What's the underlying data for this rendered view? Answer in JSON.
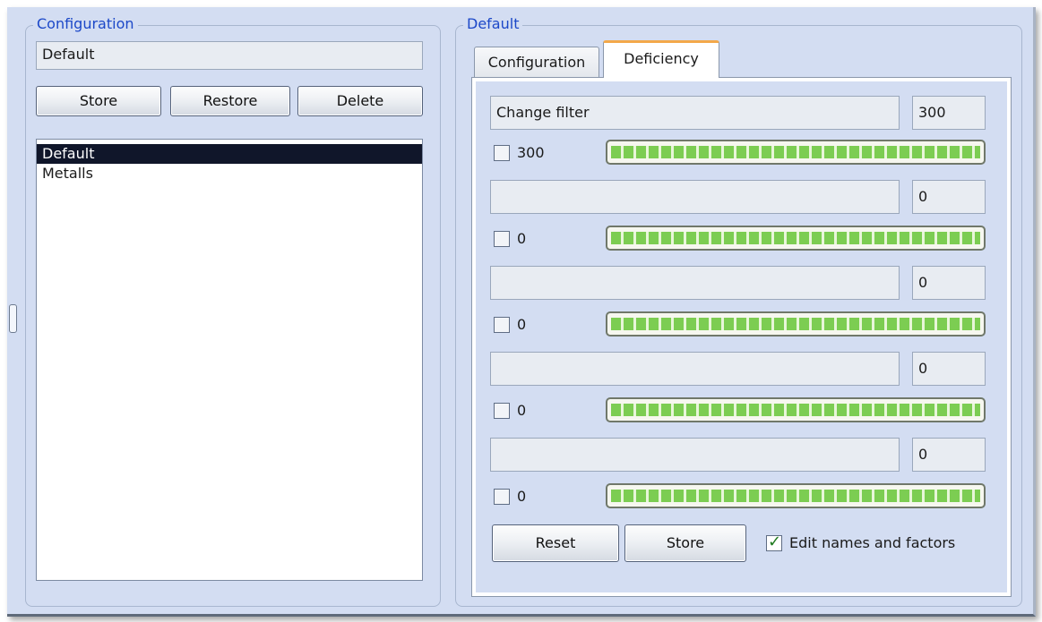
{
  "left_group": {
    "title": "Configuration",
    "name_value": "Default",
    "buttons": {
      "store": "Store",
      "restore": "Restore",
      "delete": "Delete"
    },
    "list": [
      "Default",
      "Metalls"
    ],
    "selected": "Default"
  },
  "right_group": {
    "title": "Default",
    "tabs": [
      {
        "label": "Configuration"
      },
      {
        "label": "Deficiency"
      }
    ],
    "active_tab": "Deficiency",
    "rows": [
      {
        "name": "Change filter",
        "factor": "300",
        "checkbox_label": "300",
        "checked": false,
        "level": 1.0
      },
      {
        "name": "",
        "factor": "0",
        "checkbox_label": "0",
        "checked": false,
        "level": 1.0
      },
      {
        "name": "",
        "factor": "0",
        "checkbox_label": "0",
        "checked": false,
        "level": 1.0
      },
      {
        "name": "",
        "factor": "0",
        "checkbox_label": "0",
        "checked": false,
        "level": 1.0
      },
      {
        "name": "",
        "factor": "0",
        "checkbox_label": "0",
        "checked": false,
        "level": 1.0
      }
    ],
    "reset_label": "Reset",
    "store_label": "Store",
    "edit_names": {
      "label": "Edit names and factors",
      "checked": true
    }
  },
  "colors": {
    "panel_bg": "#d3ddf2",
    "group_title": "#1c48c8",
    "meter_green": "#7ccd52",
    "tab_accent": "#f3a84a"
  }
}
